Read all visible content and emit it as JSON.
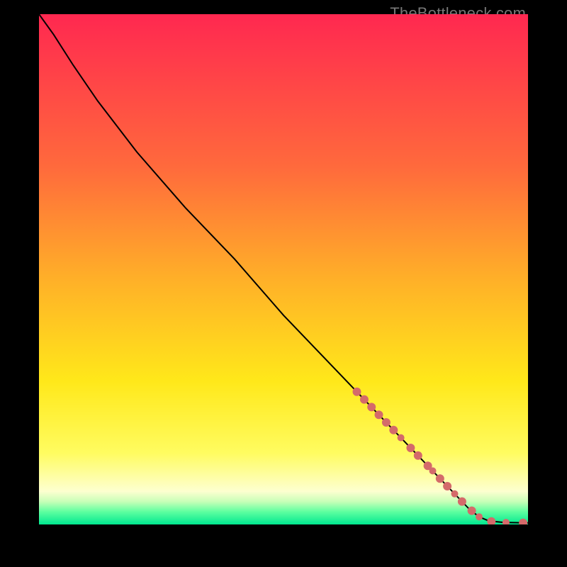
{
  "watermark": "TheBottleneck.com",
  "chart_data": {
    "type": "line",
    "xlim": [
      0,
      100
    ],
    "ylim": [
      0,
      100
    ],
    "curve": [
      {
        "x": 0,
        "y": 100
      },
      {
        "x": 3,
        "y": 96
      },
      {
        "x": 7,
        "y": 90
      },
      {
        "x": 12,
        "y": 83
      },
      {
        "x": 20,
        "y": 73
      },
      {
        "x": 30,
        "y": 62
      },
      {
        "x": 40,
        "y": 52
      },
      {
        "x": 50,
        "y": 41
      },
      {
        "x": 60,
        "y": 31
      },
      {
        "x": 65,
        "y": 26
      },
      {
        "x": 70,
        "y": 21
      },
      {
        "x": 75,
        "y": 16
      },
      {
        "x": 80,
        "y": 11
      },
      {
        "x": 85,
        "y": 6
      },
      {
        "x": 88,
        "y": 3
      },
      {
        "x": 90,
        "y": 1.5
      },
      {
        "x": 92,
        "y": 0.7
      },
      {
        "x": 95,
        "y": 0.4
      },
      {
        "x": 100,
        "y": 0.3
      }
    ],
    "markers": [
      {
        "x": 65.0,
        "y": 26.0,
        "r": 6
      },
      {
        "x": 66.5,
        "y": 24.5,
        "r": 6
      },
      {
        "x": 68.0,
        "y": 23.0,
        "r": 6
      },
      {
        "x": 69.5,
        "y": 21.5,
        "r": 6
      },
      {
        "x": 71.0,
        "y": 20.0,
        "r": 6
      },
      {
        "x": 72.5,
        "y": 18.5,
        "r": 6
      },
      {
        "x": 74.0,
        "y": 17.0,
        "r": 5
      },
      {
        "x": 76.0,
        "y": 15.0,
        "r": 6
      },
      {
        "x": 77.5,
        "y": 13.5,
        "r": 6
      },
      {
        "x": 79.5,
        "y": 11.5,
        "r": 6
      },
      {
        "x": 80.5,
        "y": 10.5,
        "r": 5
      },
      {
        "x": 82.0,
        "y": 9.0,
        "r": 6
      },
      {
        "x": 83.5,
        "y": 7.5,
        "r": 6
      },
      {
        "x": 85.0,
        "y": 6.0,
        "r": 5
      },
      {
        "x": 86.5,
        "y": 4.5,
        "r": 6
      },
      {
        "x": 88.5,
        "y": 2.7,
        "r": 6
      },
      {
        "x": 90.0,
        "y": 1.5,
        "r": 5
      },
      {
        "x": 92.5,
        "y": 0.6,
        "r": 6
      },
      {
        "x": 95.5,
        "y": 0.4,
        "r": 5
      },
      {
        "x": 99.0,
        "y": 0.3,
        "r": 6
      }
    ],
    "marker_color": "#d46a6a",
    "curve_color": "#000000",
    "gradient_stops": [
      {
        "offset": 0,
        "color": "#ff2850"
      },
      {
        "offset": 0.3,
        "color": "#ff6a3c"
      },
      {
        "offset": 0.52,
        "color": "#ffb028"
      },
      {
        "offset": 0.72,
        "color": "#ffe81a"
      },
      {
        "offset": 0.86,
        "color": "#fffc60"
      },
      {
        "offset": 0.935,
        "color": "#fdffd0"
      },
      {
        "offset": 0.955,
        "color": "#c8ffb8"
      },
      {
        "offset": 0.975,
        "color": "#5effa0"
      },
      {
        "offset": 1.0,
        "color": "#00e890"
      }
    ]
  }
}
